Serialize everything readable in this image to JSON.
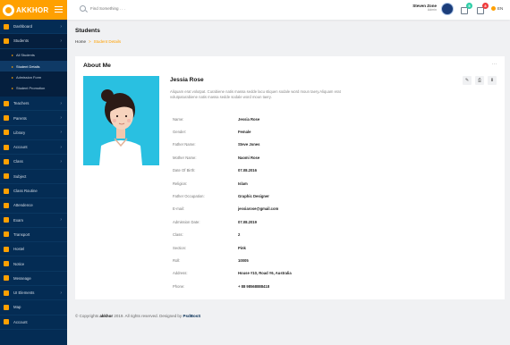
{
  "brand": {
    "name": "AKKHOR"
  },
  "sidebar": {
    "items": [
      {
        "label": "Dashboard",
        "chevron": true
      },
      {
        "label": "Students",
        "chevron": true
      }
    ],
    "students_submenu": [
      {
        "label": "All Students"
      },
      {
        "label": "Student Details"
      },
      {
        "label": "Admission Form"
      },
      {
        "label": "Student Promotion"
      }
    ],
    "items_after": [
      {
        "label": "Teachers",
        "chevron": true
      },
      {
        "label": "Parents",
        "chevron": true
      },
      {
        "label": "Library",
        "chevron": true
      },
      {
        "label": "Account",
        "chevron": true
      },
      {
        "label": "Class",
        "chevron": true
      },
      {
        "label": "Subject",
        "chevron": false
      },
      {
        "label": "Class Routine",
        "chevron": false
      },
      {
        "label": "Attendence",
        "chevron": false
      },
      {
        "label": "Exam",
        "chevron": true
      },
      {
        "label": "Transport",
        "chevron": false
      },
      {
        "label": "Hostel",
        "chevron": false
      },
      {
        "label": "Notice",
        "chevron": false
      },
      {
        "label": "Messeage",
        "chevron": false
      },
      {
        "label": "UI Elements",
        "chevron": true
      },
      {
        "label": "Map",
        "chevron": false
      },
      {
        "label": "Account",
        "chevron": false
      }
    ]
  },
  "header": {
    "search_placeholder": "Find Something . . .",
    "user_name": "Steven Zone",
    "user_role": "Admin",
    "message_badge": "5",
    "notification_badge": "8",
    "language": "EN"
  },
  "page": {
    "title": "Students",
    "breadcrumb_home": "Home",
    "breadcrumb_current": "Student Details"
  },
  "card": {
    "title": "About Me",
    "menu_dots": "...",
    "student_name": "Jessia Rose",
    "about_text": "Aliquam erat volutpat. Curabiene natis massa sedde lacu stiquen sodale word moun taery.Aliquam erat volutpaturabiene natis massa sedde sodale word moun taery.",
    "details": [
      {
        "label": "Name:",
        "value": "Jessia Rose"
      },
      {
        "label": "Gender:",
        "value": "Female"
      },
      {
        "label": "Father Name:",
        "value": "Steve Jones"
      },
      {
        "label": "Mother Name:",
        "value": "Naomi Rose"
      },
      {
        "label": "Date Of Birth:",
        "value": "07.08.2016"
      },
      {
        "label": "Religion:",
        "value": "Islam"
      },
      {
        "label": "Father Occupation:",
        "value": "Graphic Designer"
      },
      {
        "label": "E-mail:",
        "value": "jessiarose@gmail.com"
      },
      {
        "label": "Admission Date:",
        "value": "07.08.2019"
      },
      {
        "label": "Class:",
        "value": "2"
      },
      {
        "label": "Section:",
        "value": "Pink"
      },
      {
        "label": "Roll:",
        "value": "10005"
      },
      {
        "label": "Address:",
        "value": "House #10, Road #6, Australia"
      },
      {
        "label": "Phone:",
        "value": "+ 88 98568888418"
      }
    ]
  },
  "footer": {
    "prefix": "© Copyrights",
    "site": "akkhor",
    "middle": "2019. All rights reserved. Designed by",
    "designer": "PsdBosS"
  },
  "colors": {
    "accent": "#ffa001",
    "sidebar": "#042c54",
    "photo_bg": "#29c0e1"
  }
}
